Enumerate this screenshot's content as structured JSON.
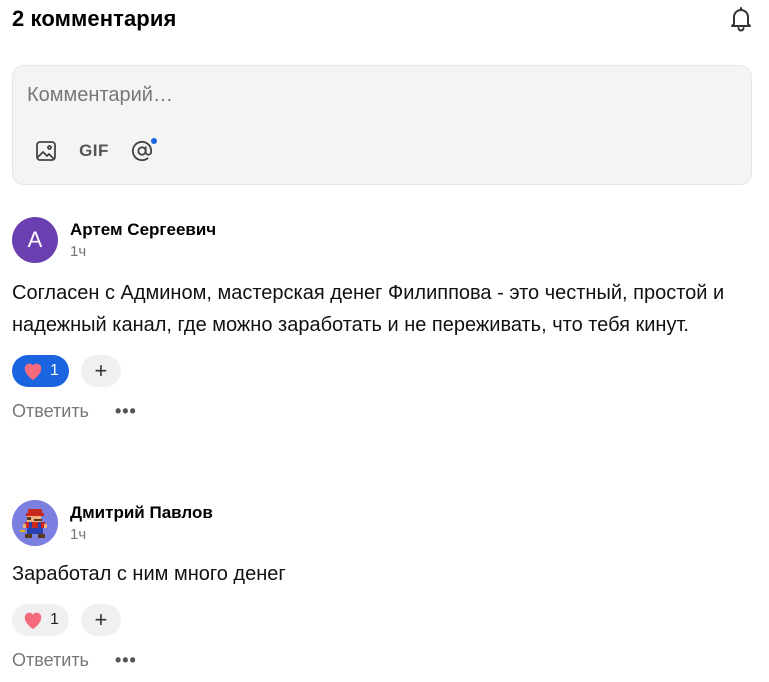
{
  "header": {
    "title": "2 комментария",
    "bell_icon": "bell-icon"
  },
  "composer": {
    "placeholder": "Комментарий…",
    "tools": {
      "image_icon": "image-icon",
      "gif_label": "GIF",
      "mention_icon": "at-sign-icon"
    },
    "accent_color": "#1967e0"
  },
  "comments": [
    {
      "avatar_letter": "А",
      "author": "Артем Сергеевич",
      "time": "1ч",
      "text": "Согласен с Админом, мастерская денег Филиппова - это честный, простой и надежный канал, где можно заработать и не переживать, что тебя кинут.",
      "reaction": {
        "icon": "heart-icon",
        "count": "1",
        "active": true
      },
      "add_reaction": "+",
      "reply_label": "Ответить",
      "more_label": "•••"
    },
    {
      "avatar_icon": "pixel-avatar-icon",
      "author": "Дмитрий Павлов",
      "time": "1ч",
      "text": "Заработал с ним много денег",
      "reaction": {
        "icon": "heart-icon",
        "count": "1",
        "active": false
      },
      "add_reaction": "+",
      "reply_label": "Ответить",
      "more_label": "•••"
    }
  ],
  "colors": {
    "reaction_active_bg": "#1a64e0",
    "avatar_purple": "#6a3fb0"
  }
}
